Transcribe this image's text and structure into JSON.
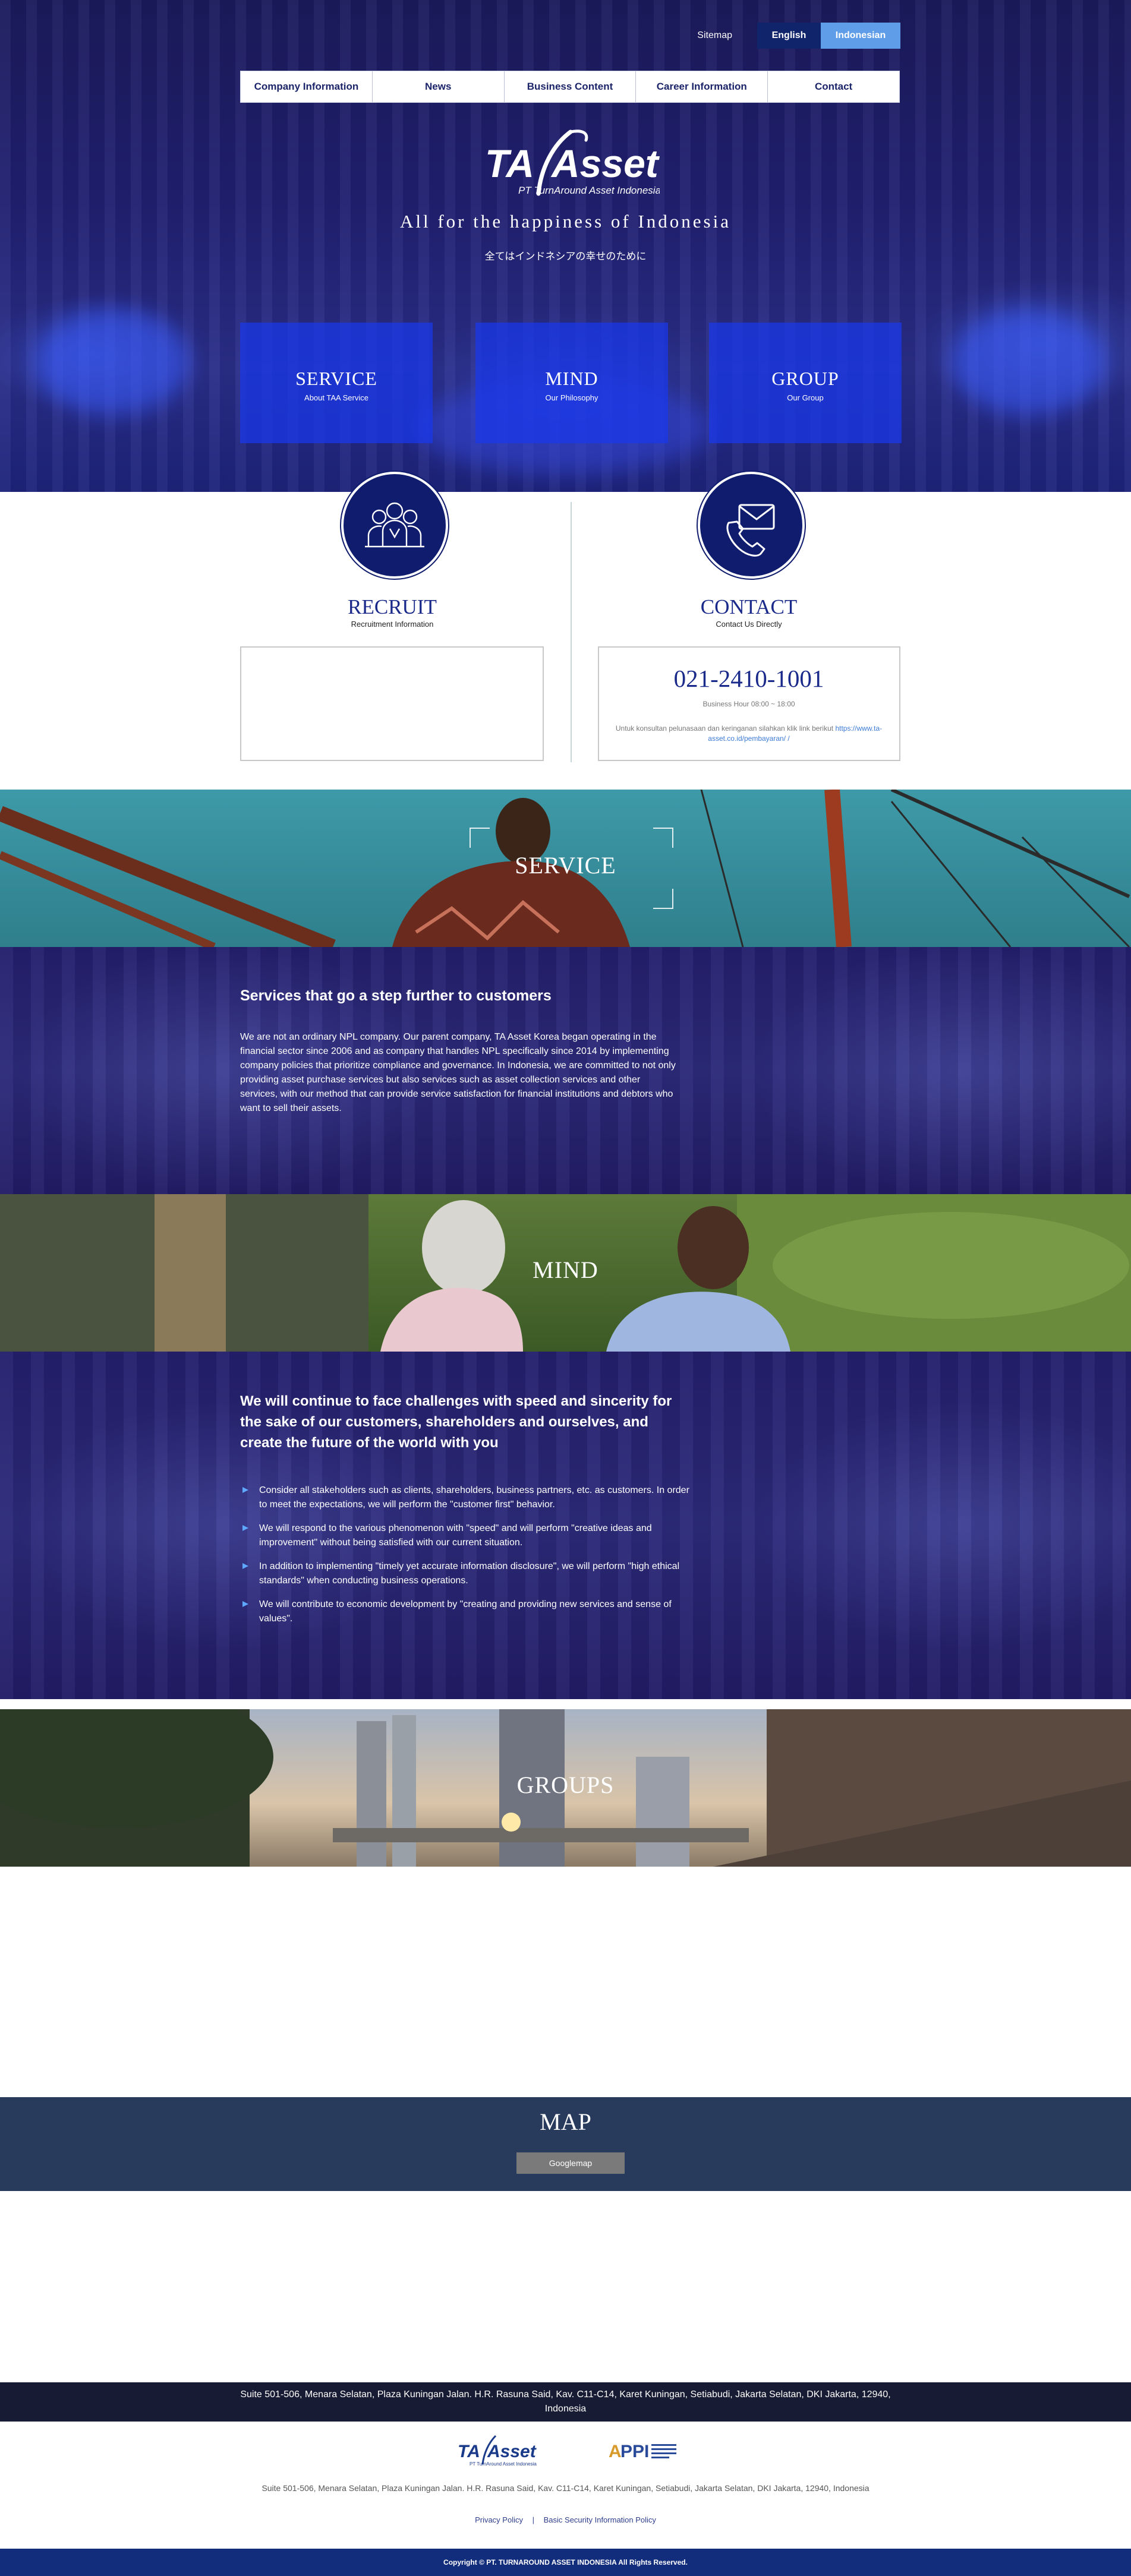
{
  "header": {
    "sitemap_label": "Sitemap",
    "lang_english": "English",
    "lang_indonesian": "Indonesian"
  },
  "nav": {
    "items": [
      "Company Information",
      "News",
      "Business Content",
      "Career Information",
      "Contact"
    ]
  },
  "hero": {
    "logo_text": "TA Asset",
    "logo_subtext": "PT TurnAround Asset Indonesia",
    "tagline": "All for the happiness of Indonesia",
    "tagline_jp": "全てはインドネシアの幸せのために",
    "cards": [
      {
        "title": "SERVICE",
        "subtitle": "About TAA Service"
      },
      {
        "title": "MIND",
        "subtitle": "Our Philosophy"
      },
      {
        "title": "GROUP",
        "subtitle": "Our Group"
      }
    ]
  },
  "recruit": {
    "icon": "people-group-icon",
    "title": "RECRUIT",
    "subtitle": "Recruitment Information"
  },
  "contact": {
    "icon": "phone-mail-icon",
    "title": "CONTACT",
    "subtitle": "Contact Us Directly",
    "phone": "021-2410-1001",
    "hours": "Business Hour 08:00 ~ 18:00",
    "consult_text": "Untuk konsultan pelunasaan dan keringanan silahkan klik link berikut",
    "consult_link": "https://www.ta-asset.co.id/pembayaran/ /"
  },
  "service_band": {
    "title": "SERVICE"
  },
  "service_section": {
    "heading": "Services that go a step further to customers",
    "body": "We are not an ordinary NPL company. Our parent company, TA Asset Korea began operating in the financial sector since 2006 and as company that handles NPL specifically since 2014 by implementing company policies that prioritize compliance and governance. In Indonesia, we are committed to not only providing asset purchase services but also services such as asset collection services and other services, with our method that can provide service satisfaction for financial institutions and debtors who want to sell their assets."
  },
  "mind_band": {
    "title": "MIND"
  },
  "mind_section": {
    "heading": "We will continue to face challenges with speed and sincerity for the sake of our customers, shareholders and ourselves, and create the future of the world with you",
    "items": [
      "Consider all stakeholders such as clients, shareholders, business partners, etc. as customers. In order to meet the expectations, we will perform the \"customer first\" behavior.",
      "We will respond to the various phenomenon with \"speed\" and will perform \"creative ideas and improvement\" without being satisfied with our current situation.",
      "In addition to implementing \"timely yet accurate information disclosure\", we will perform \"high ethical standards\" when conducting business operations.",
      "We will contribute to economic development by \"creating and providing new services and sense of values\"."
    ]
  },
  "groups_band": {
    "title": "GROUPS"
  },
  "map": {
    "title": "MAP",
    "button_label": "Googlemap"
  },
  "footer": {
    "address_top": "Suite 501-506, Menara Selatan, Plaza Kuningan Jalan. H.R. Rasuna Said, Kav. C11-C14, Karet Kuningan, Setiabudi, Jakarta Selatan, DKI Jakarta, 12940, Indonesia",
    "logo_text": "TA Asset",
    "logo_subtext": "PT TurnAround Asset Indonesia",
    "appi_text": "APPI",
    "address_bottom": "Suite 501-506, Menara Selatan, Plaza Kuningan Jalan. H.R. Rasuna Said, Kav. C11-C14, Karet Kuningan, Setiabudi, Jakarta Selatan, DKI Jakarta, 12940, Indonesia",
    "privacy_label": "Privacy Policy",
    "separator": "|",
    "security_label": "Basic Security Information Policy",
    "copyright": "Copyright © PT. TURNAROUND ASSET INDONESIA All Rights Reserved."
  },
  "colors": {
    "navy": "#101c6e",
    "hero_card": "#1937eb",
    "lang_active": "#10246b",
    "lang_alt": "#5f9de8",
    "map_bg": "#293b5c",
    "copyright_bg": "#132d7d"
  }
}
